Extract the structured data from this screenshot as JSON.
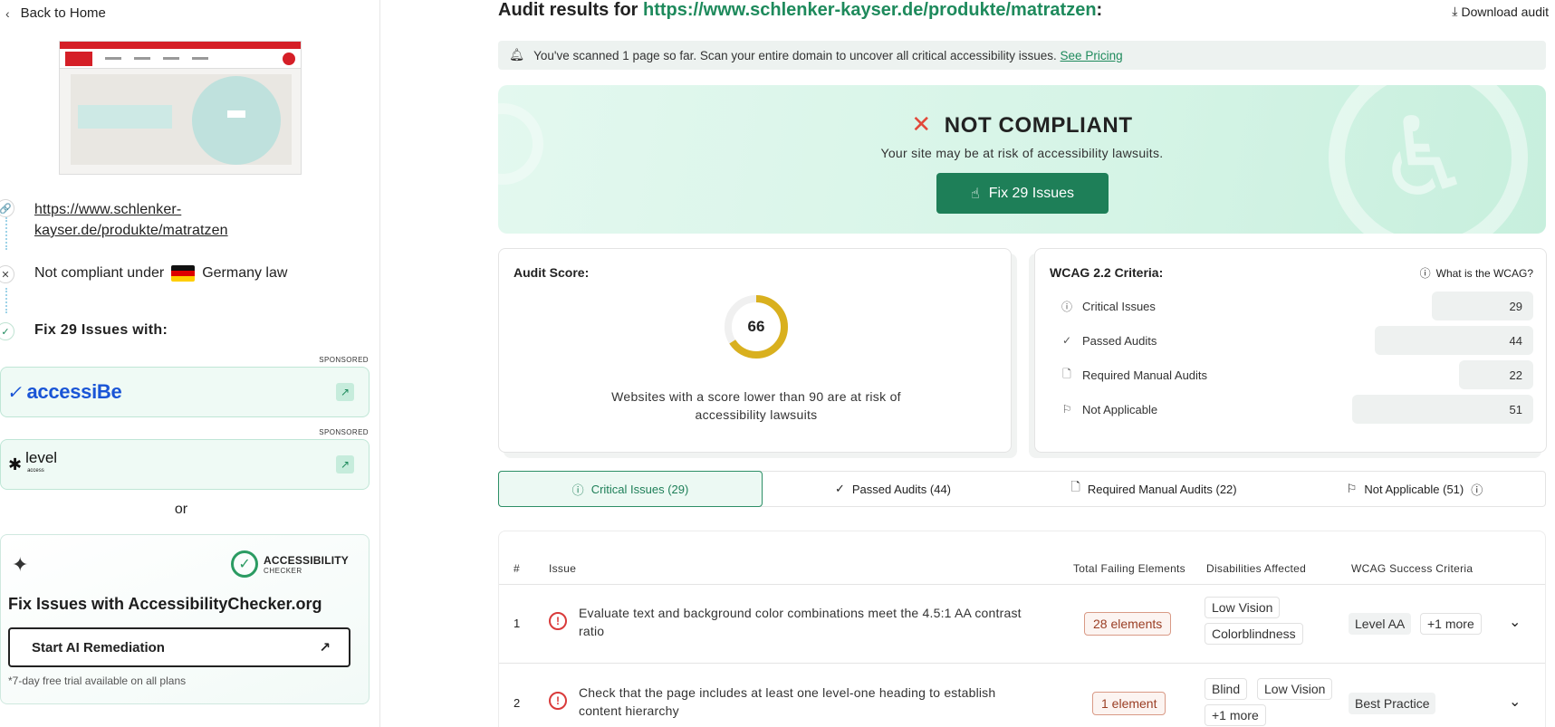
{
  "sidebar": {
    "back_label": "Back to Home",
    "url": "https://www.schlenker-kayser.de/produkte/matratzen",
    "noncompliant_prefix": "Not compliant under",
    "noncompliant_law": "Germany law",
    "fix_with_label": "Fix 29 Issues with:",
    "sponsored_label": "SPONSORED",
    "ads": [
      {
        "brand": "accessiBe"
      },
      {
        "brand": "level",
        "sub": "access"
      }
    ],
    "or_label": "or",
    "promo": {
      "logo_line1": "ACCESSIBILITY",
      "logo_line2": "CHECKER",
      "title": "Fix Issues with AccessibilityChecker.org",
      "button_label": "Start AI Remediation",
      "note": "*7-day free trial available on all plans"
    }
  },
  "main": {
    "title_prefix": "Audit results for",
    "title_url": "https://www.schlenker-kayser.de/produkte/matratzen",
    "title_suffix": ":",
    "download_label": "Download audit",
    "banner_text": "You've scanned 1 page so far. Scan your entire domain to uncover all critical accessibility issues.",
    "banner_link": "See Pricing",
    "hero": {
      "status": "NOT COMPLIANT",
      "subtitle": "Your site may be at risk of accessibility lawsuits.",
      "button_label": "Fix 29 Issues"
    },
    "score": {
      "title": "Audit Score:",
      "value": 66,
      "note": "Websites with a score lower than 90 are at risk of accessibility lawsuits",
      "gauge_color": "#d9b01e"
    },
    "wcag": {
      "title": "WCAG 2.2 Criteria:",
      "help_label": "What is the WCAG?",
      "rows": [
        {
          "label": "Critical Issues",
          "value": "29",
          "icon": "alert-circle-icon"
        },
        {
          "label": "Passed Audits",
          "value": "44",
          "icon": "check-icon"
        },
        {
          "label": "Required Manual Audits",
          "value": "22",
          "icon": "document-icon"
        },
        {
          "label": "Not Applicable",
          "value": "51",
          "icon": "flag-icon"
        }
      ]
    },
    "tabs": [
      {
        "label": "Critical Issues (29)",
        "active": true
      },
      {
        "label": "Passed Audits (44)"
      },
      {
        "label": "Required Manual Audits (22)"
      },
      {
        "label": "Not Applicable (51)"
      }
    ],
    "table": {
      "headers": [
        "#",
        "Issue",
        "Total Failing Elements",
        "Disabilities Affected",
        "WCAG Success Criteria"
      ],
      "rows": [
        {
          "num": "1",
          "issue": "Evaluate text and background color combinations meet the 4.5:1 AA contrast ratio",
          "elements": "28 elements",
          "disabilities": [
            "Low Vision",
            "Colorblindness"
          ],
          "criteria": [
            "Level AA",
            "+1 more"
          ]
        },
        {
          "num": "2",
          "issue": "Check that the page includes at least one level-one heading to establish content hierarchy",
          "elements": "1 element",
          "disabilities": [
            "Blind",
            "Low Vision",
            "+1 more"
          ],
          "criteria": [
            "Best Practice"
          ]
        }
      ]
    }
  },
  "colors": {
    "accent": "#1e7f58",
    "danger": "#d93a3a",
    "hero_bg": "#d5f4e6"
  }
}
